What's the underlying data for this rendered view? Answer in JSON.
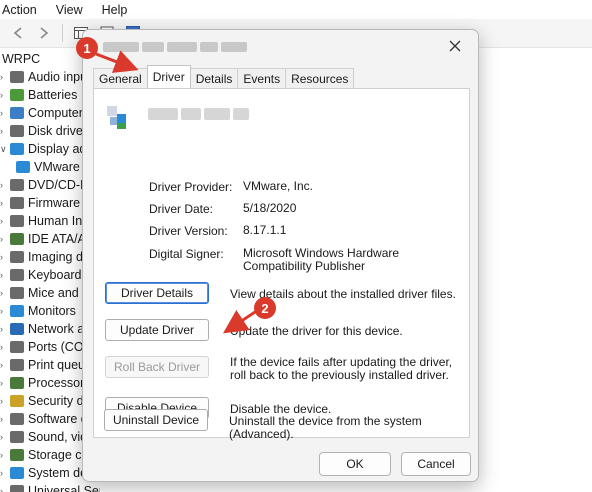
{
  "menubar": {
    "items": [
      "Action",
      "View",
      "Help"
    ]
  },
  "tree": {
    "root": "WRPC",
    "items": [
      {
        "label": "Audio input",
        "color": "#6a6a6a",
        "expanded": false
      },
      {
        "label": "Batteries",
        "color": "#4a9a3a",
        "expanded": false
      },
      {
        "label": "Computer",
        "color": "#3c7fc4",
        "expanded": false
      },
      {
        "label": "Disk drives",
        "color": "#6a6a6a",
        "expanded": false
      },
      {
        "label": "Display ada",
        "color": "#2a8ad4",
        "expanded": true
      },
      {
        "label": "VMware",
        "color": "#2a8ad4",
        "child": true
      },
      {
        "label": "DVD/CD-RO",
        "color": "#6a6a6a",
        "expanded": false
      },
      {
        "label": "Firmware",
        "color": "#6a6a6a",
        "expanded": false
      },
      {
        "label": "Human Inte",
        "color": "#6a6a6a",
        "expanded": false
      },
      {
        "label": "IDE ATA/AT",
        "color": "#4a7a3a",
        "expanded": false
      },
      {
        "label": "Imaging dev",
        "color": "#6a6a6a",
        "expanded": false
      },
      {
        "label": "Keyboards",
        "color": "#6a6a6a",
        "expanded": false
      },
      {
        "label": "Mice and ot",
        "color": "#6a6a6a",
        "expanded": false
      },
      {
        "label": "Monitors",
        "color": "#2a8ad4",
        "expanded": false
      },
      {
        "label": "Network ad",
        "color": "#2a6ab4",
        "expanded": false
      },
      {
        "label": "Ports (COM",
        "color": "#6a6a6a",
        "expanded": false
      },
      {
        "label": "Print queue",
        "color": "#6a6a6a",
        "expanded": false
      },
      {
        "label": "Processors",
        "color": "#4a7a3a",
        "expanded": false
      },
      {
        "label": "Security dev",
        "color": "#c9a227",
        "expanded": false
      },
      {
        "label": "Software dev",
        "color": "#6a6a6a",
        "expanded": false
      },
      {
        "label": "Sound, vide",
        "color": "#6a6a6a",
        "expanded": false
      },
      {
        "label": "Storage con",
        "color": "#4a7a3a",
        "expanded": false
      },
      {
        "label": "System dev",
        "color": "#2a8ad4",
        "expanded": false
      },
      {
        "label": "Universal Serial Bus controllers",
        "color": "#6a6a6a",
        "expanded": false
      }
    ]
  },
  "dialog": {
    "tabs": [
      "General",
      "Driver",
      "Details",
      "Events",
      "Resources"
    ],
    "active_tab": "Driver",
    "properties": [
      {
        "label": "Driver Provider:",
        "value": "VMware, Inc."
      },
      {
        "label": "Driver Date:",
        "value": "5/18/2020"
      },
      {
        "label": "Driver Version:",
        "value": "8.17.1.1"
      },
      {
        "label": "Digital Signer:",
        "value": "Microsoft Windows Hardware Compatibility Publisher"
      }
    ],
    "actions": [
      {
        "button": "Driver Details",
        "desc": "View details about the installed driver files.",
        "state": "focused"
      },
      {
        "button": "Update Driver",
        "desc": "Update the driver for this device.",
        "state": "normal"
      },
      {
        "button": "Roll Back Driver",
        "desc": "If the device fails after updating the driver, roll back to the previously installed driver.",
        "state": "disabled"
      },
      {
        "button": "Disable Device",
        "desc": "Disable the device.",
        "state": "normal"
      },
      {
        "button": "Uninstall Device",
        "desc": "Uninstall the device from the system (Advanced).",
        "state": "normal"
      }
    ],
    "ok_label": "OK",
    "cancel_label": "Cancel"
  },
  "annotations": {
    "badge1": "1",
    "badge2": "2",
    "color": "#d93a2b"
  }
}
